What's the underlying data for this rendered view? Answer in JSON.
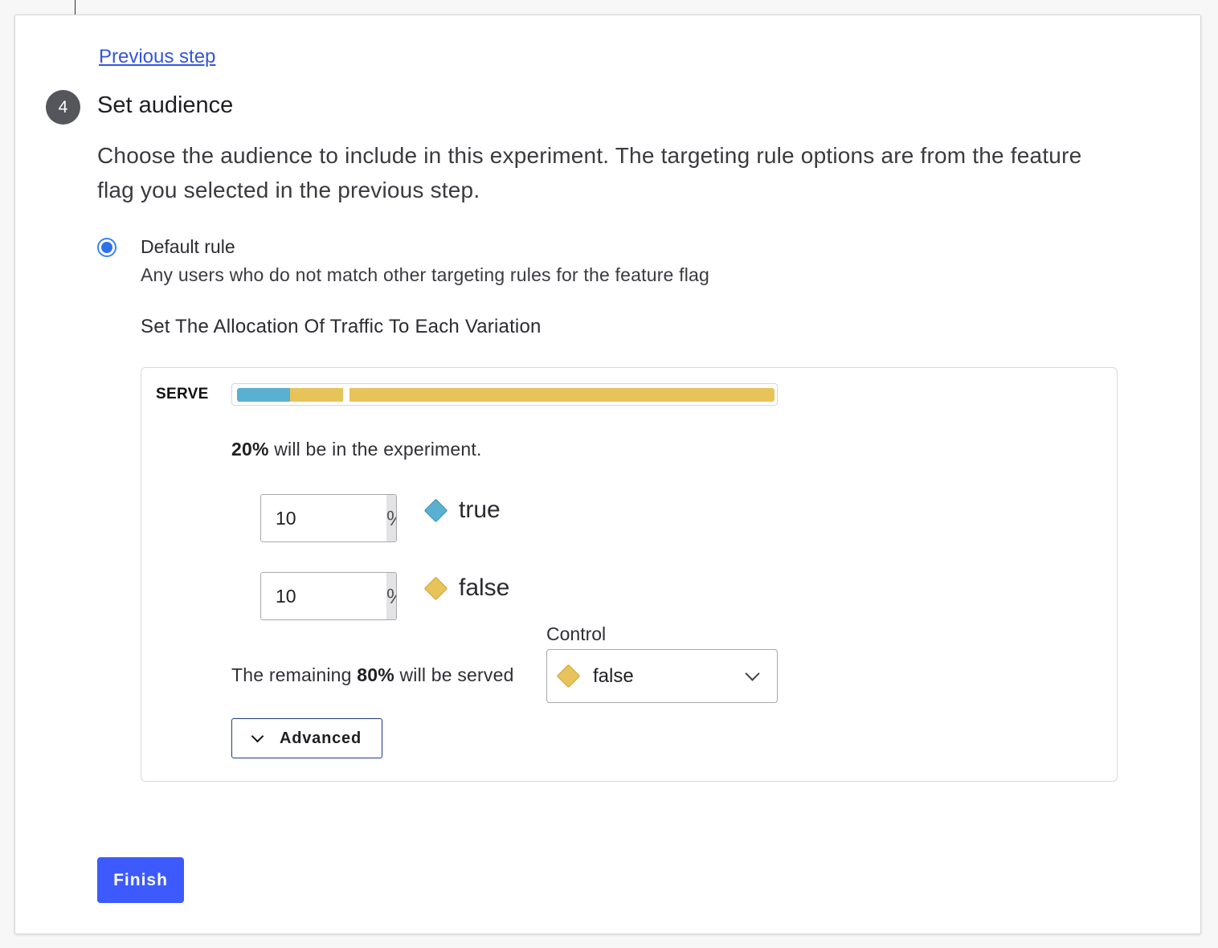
{
  "navigation": {
    "previous_step_label": "Previous step"
  },
  "step": {
    "number": "4",
    "title": "Set audience",
    "description": "Choose the audience to include in this experiment. The targeting rule options are from the feature flag you selected in the previous step."
  },
  "rule": {
    "selected": true,
    "title": "Default rule",
    "description": "Any users who do not match other targeting rules for the feature flag"
  },
  "allocation": {
    "heading": "Set The Allocation Of Traffic To Each Variation",
    "serve_label": "SERVE",
    "bar": {
      "true_percent": 10,
      "false_percent": 10,
      "control_percent": 80
    },
    "experiment_percent": "20%",
    "experiment_text": " will be in the experiment.",
    "variations": [
      {
        "value": "10",
        "suffix": "%",
        "name": "true",
        "color": "#5ab0d0",
        "icon": "diamond-icon"
      },
      {
        "value": "10",
        "suffix": "%",
        "name": "false",
        "color": "#e7c35a",
        "icon": "diamond-icon"
      }
    ],
    "remaining_prefix": "The remaining ",
    "remaining_percent": "80%",
    "remaining_suffix": " will be served",
    "control": {
      "label": "Control",
      "selected_value": "false",
      "color": "#e7c35a"
    },
    "advanced_label": "Advanced"
  },
  "actions": {
    "finish_label": "Finish",
    "finish_color": "#3d5afe"
  }
}
